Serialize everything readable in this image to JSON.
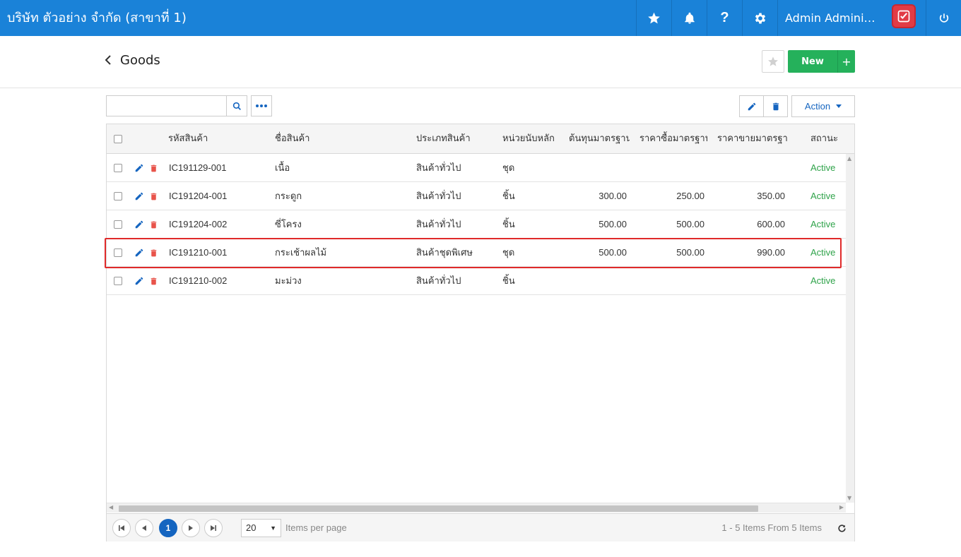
{
  "topbar": {
    "company": "บริษัท ตัวอย่าง จำกัด (สาขาที่ 1)",
    "user": "Admin Administrator",
    "icons": [
      "star-icon",
      "bell-icon",
      "help-icon",
      "gear-icon",
      "power-icon"
    ]
  },
  "header": {
    "title": "Goods",
    "new_label": "New",
    "plus_label": "+"
  },
  "toolbar": {
    "search_placeholder": "",
    "action_label": "Action"
  },
  "table": {
    "columns": [
      "รหัสสินค้า",
      "ชื่อสินค้า",
      "ประเภทสินค้า",
      "หน่วยนับหลัก",
      "ต้นทุนมาตรฐาน",
      "ราคาซื้อมาตรฐาน",
      "ราคาขายมาตรฐาน",
      "สถานะ"
    ],
    "rows": [
      {
        "code": "IC191129-001",
        "name": "เนื้อ",
        "type": "สินค้าทั่วไป",
        "unit": "ชุด",
        "cost": "",
        "buy": "",
        "sell": "",
        "status": "Active"
      },
      {
        "code": "IC191204-001",
        "name": "กระดูก",
        "type": "สินค้าทั่วไป",
        "unit": "ชิ้น",
        "cost": "300.00",
        "buy": "250.00",
        "sell": "350.00",
        "status": "Active"
      },
      {
        "code": "IC191204-002",
        "name": "ซี่โครง",
        "type": "สินค้าทั่วไป",
        "unit": "ชิ้น",
        "cost": "500.00",
        "buy": "500.00",
        "sell": "600.00",
        "status": "Active"
      },
      {
        "code": "IC191210-001",
        "name": "กระเช้าผลไม้",
        "type": "สินค้าชุดพิเศษ",
        "unit": "ชุด",
        "cost": "500.00",
        "buy": "500.00",
        "sell": "990.00",
        "status": "Active"
      },
      {
        "code": "IC191210-002",
        "name": "มะม่วง",
        "type": "สินค้าทั่วไป",
        "unit": "ชิ้น",
        "cost": "",
        "buy": "",
        "sell": "",
        "status": "Active"
      }
    ]
  },
  "pager": {
    "current_page": "1",
    "page_size": "20",
    "items_per_page_label": "Items per page",
    "info": "1 - 5 Items From 5 Items"
  },
  "colors": {
    "topbar": "#1a82d8",
    "primary": "#1565c0",
    "success": "#25b15b",
    "danger": "#e8534a",
    "status_active": "#2fa34a",
    "highlight": "#e02a2a"
  }
}
